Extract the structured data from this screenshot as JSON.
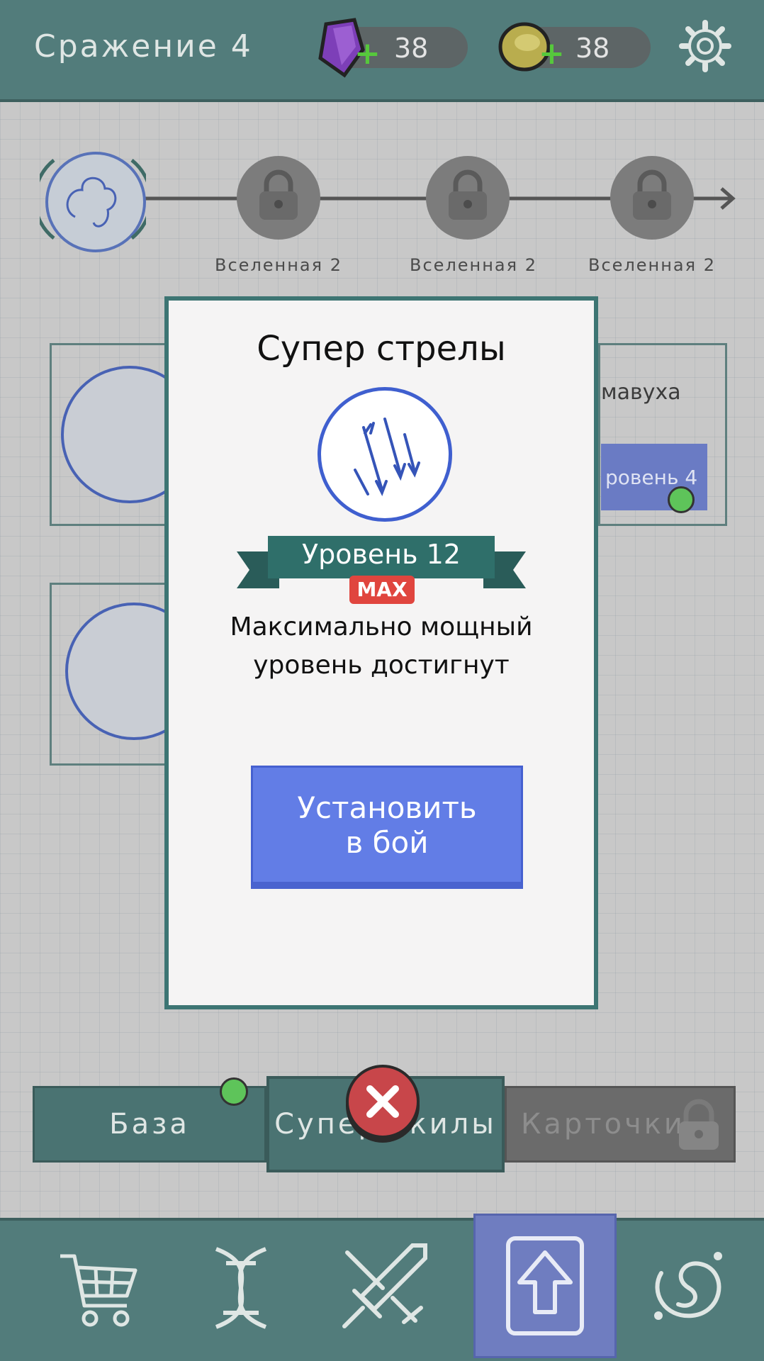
{
  "header": {
    "title": "Сражение 4",
    "gems": "38",
    "coins": "38"
  },
  "progress": {
    "nodes": [
      {
        "label": "Вселенная 2"
      },
      {
        "label": "Вселенная 2"
      },
      {
        "label": "Вселенная 2"
      }
    ]
  },
  "background_cards": {
    "right_card_name": "мавуха",
    "right_card_level": "ровень 4"
  },
  "modal": {
    "title": "Супер стрелы",
    "level": "Уровень 12",
    "max_badge": "MAX",
    "description_line1": "Максимально мощный",
    "description_line2": "уровень достигнут",
    "button_line1": "Установить",
    "button_line2": "в бой"
  },
  "tabs": [
    {
      "label": "База"
    },
    {
      "label": "Супер скилы"
    },
    {
      "label": "Карточки"
    }
  ],
  "colors": {
    "topbar": "#527c7b",
    "accent_blue": "#627de6",
    "ribbon": "#2f6f6a",
    "max_red": "#e0453e",
    "notif_green": "#5ec45a"
  }
}
